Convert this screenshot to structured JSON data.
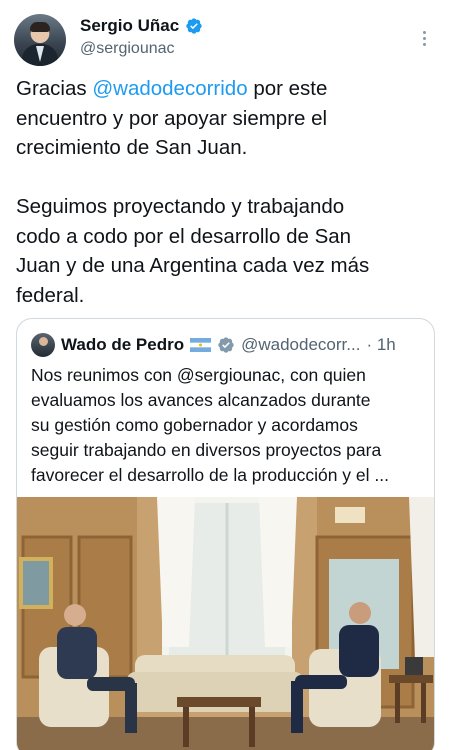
{
  "author": {
    "display_name": "Sergio Uñac",
    "handle": "@sergiounac",
    "verified_icon": "verified-badge-icon"
  },
  "tweet": {
    "lines_p1": [
      "Gracias ",
      "@wadodecorrido",
      " por este",
      "encuentro y por apoyar siempre el",
      "crecimiento de San Juan."
    ],
    "lines_p2": [
      "Seguimos proyectando y trabajando",
      "codo a codo por el desarrollo de San",
      "Juan y de una Argentina cada vez más",
      "federal."
    ]
  },
  "quoted": {
    "display_name": "Wado de Pedro",
    "flag_icon": "argentina-flag-icon",
    "handle": "@wadodecorr...",
    "time": "· 1h",
    "lines": [
      "Nos reunimos con @sergiounac, con quien",
      "evaluamos los avances alcanzados durante",
      "su gestión como gobernador y acordamos",
      "seguir trabajando en diversos proyectos para",
      "favorecer el desarrollo de la producción y el ..."
    ]
  },
  "colors": {
    "accent": "#1d9bf0",
    "text": "#0f1419",
    "secondary": "#536471",
    "border": "#cfd9de"
  }
}
